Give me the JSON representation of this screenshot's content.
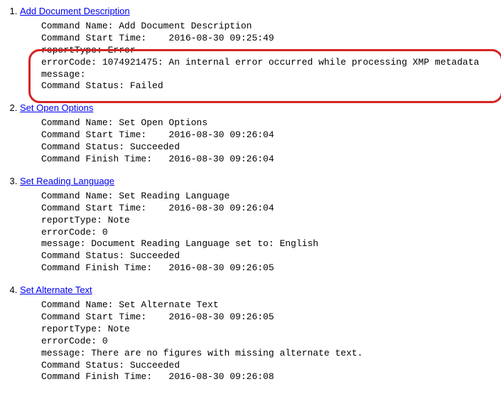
{
  "sections": [
    {
      "number": "1",
      "title": "Add Document Description",
      "lines": [
        "Command Name: Add Document Description",
        "Command Start Time:    2016-08-30 09:25:49",
        "reportType: Error",
        "errorCode: 1074921475: An internal error occurred while processing XMP metadata",
        "message:",
        "Command Status: Failed"
      ]
    },
    {
      "number": "2",
      "title": "Set Open Options",
      "lines": [
        "Command Name: Set Open Options",
        "Command Start Time:    2016-08-30 09:26:04",
        "Command Status: Succeeded",
        "Command Finish Time:   2016-08-30 09:26:04"
      ]
    },
    {
      "number": "3",
      "title": "Set Reading Language",
      "lines": [
        "Command Name: Set Reading Language",
        "Command Start Time:    2016-08-30 09:26:04",
        "reportType: Note",
        "errorCode: 0",
        "message: Document Reading Language set to: English",
        "Command Status: Succeeded",
        "Command Finish Time:   2016-08-30 09:26:05"
      ]
    },
    {
      "number": "4",
      "title": "Set Alternate Text",
      "lines": [
        "Command Name: Set Alternate Text",
        "Command Start Time:    2016-08-30 09:26:05",
        "reportType: Note",
        "errorCode: 0",
        "message: There are no figures with missing alternate text.",
        "Command Status: Succeeded",
        "Command Finish Time:   2016-08-30 09:26:08"
      ]
    }
  ]
}
